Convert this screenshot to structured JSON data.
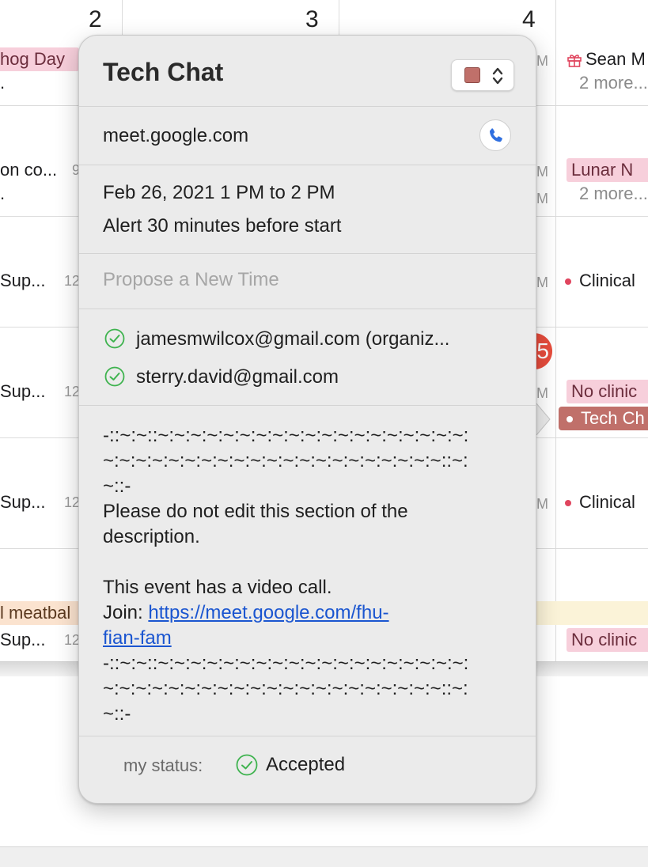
{
  "calendar": {
    "day_numbers": [
      "2",
      "3",
      "4"
    ],
    "today_badge": "5",
    "events": {
      "groundhog": "hog Day",
      "groundhog_more": ".",
      "sean": "Sean M",
      "sean_more": "2 more...",
      "lunar": "Lunar N",
      "lunar_more": "2 more...",
      "row2_left": "on co...",
      "row2_left_more": ".",
      "row2_time": "9",
      "sup": "Sup...",
      "sup_time": "12",
      "clinical": "Clinical",
      "no_clinic": "No clinic",
      "tech_chat": "Tech Ch",
      "meatball": "l meatbal",
      "pm_fragment": "M"
    }
  },
  "popover": {
    "title": "Tech Chat",
    "color": "#c0706a",
    "location": "meet.google.com",
    "date_time": "Feb 26, 2021  1 PM to 2 PM",
    "alert": "Alert 30 minutes before start",
    "propose_placeholder": "Propose a New Time",
    "attendees": [
      {
        "email": "jamesmwilcox@gmail.com (organiz...",
        "status": "accepted"
      },
      {
        "email": "sterry.david@gmail.com",
        "status": "accepted"
      }
    ],
    "notes": {
      "divider_top_1": "-::~:~::~:~:~:~:~:~:~:~:~:~:~:~:~:~:~:~:~:~:~:",
      "divider_top_2": "~:~:~:~:~:~:~:~:~:~:~:~:~:~:~:~:~:~:~:~:~::~:",
      "divider_top_3": "~::-",
      "line1": "Please do not edit this section of the",
      "line2": "description.",
      "line3": "This event has a video call.",
      "join_label": "Join: ",
      "join_link_1": "https://meet.google.com/fhu-",
      "join_link_2": "fian-fam",
      "divider_bottom_1": "-::~:~::~:~:~:~:~:~:~:~:~:~:~:~:~:~:~:~:~:~:~:",
      "divider_bottom_2": "~:~:~:~:~:~:~:~:~:~:~:~:~:~:~:~:~:~:~:~:~::~:",
      "divider_bottom_3": "~::-"
    },
    "my_status_label": "my status:",
    "my_status_value": "Accepted"
  },
  "colors": {
    "event_red": "#c0706a",
    "accepted_green": "#3fb34f",
    "link_blue": "#1a55d0",
    "today_red": "#e74c3c",
    "phone_blue": "#2f6fe0"
  }
}
